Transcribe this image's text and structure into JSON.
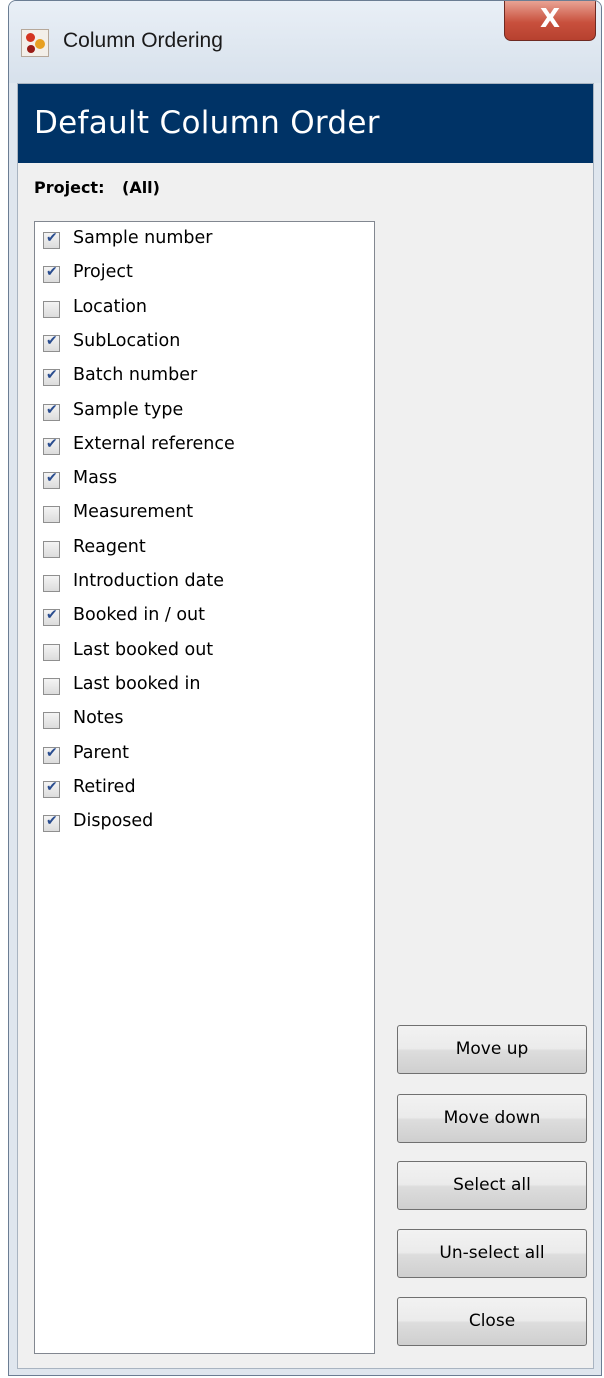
{
  "window": {
    "title": "Column Ordering",
    "close_glyph": "X",
    "icon": "app-logo-icon"
  },
  "header": {
    "title": "Default Column Order"
  },
  "project": {
    "label": "Project:",
    "value": "(All)"
  },
  "columns": [
    {
      "label": "Sample number",
      "checked": true
    },
    {
      "label": "Project",
      "checked": true
    },
    {
      "label": "Location",
      "checked": false
    },
    {
      "label": "SubLocation",
      "checked": true
    },
    {
      "label": "Batch number",
      "checked": true
    },
    {
      "label": "Sample type",
      "checked": true
    },
    {
      "label": "External reference",
      "checked": true
    },
    {
      "label": "Mass",
      "checked": true
    },
    {
      "label": "Measurement",
      "checked": false
    },
    {
      "label": "Reagent",
      "checked": false
    },
    {
      "label": "Introduction date",
      "checked": false
    },
    {
      "label": "Booked in / out",
      "checked": true
    },
    {
      "label": "Last booked out",
      "checked": false
    },
    {
      "label": "Last booked in",
      "checked": false
    },
    {
      "label": "Notes",
      "checked": false
    },
    {
      "label": "Parent",
      "checked": true
    },
    {
      "label": "Retired",
      "checked": true
    },
    {
      "label": "Disposed",
      "checked": true
    }
  ],
  "buttons": {
    "move_up": "Move up",
    "move_down": "Move down",
    "select_all": "Select all",
    "unselect_all": "Un-select all",
    "close": "Close"
  },
  "colors": {
    "header_bg": "#003366",
    "check_mark": "#2a4d8f",
    "close_button": "#c8503d"
  }
}
